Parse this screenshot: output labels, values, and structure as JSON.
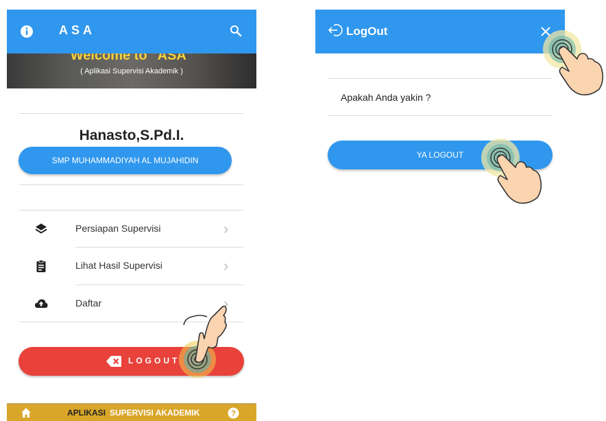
{
  "left_screen": {
    "app_bar": {
      "title": "ASA",
      "info_icon": "info-icon",
      "search_icon": "search-icon"
    },
    "banner": {
      "welcome": "Welcome to \"ASA\"",
      "subtitle": "( Aplikasi Supervisi Akademik )"
    },
    "profile": {
      "name": "Hanasto,S.Pd.I.",
      "school": "SMP MUHAMMADIYAH AL MUJAHIDIN"
    },
    "menu": [
      {
        "label": "Persiapan Supervisi",
        "icon": "layers-icon"
      },
      {
        "label": "Lihat Hasil Supervisi",
        "icon": "clipboard-icon"
      },
      {
        "label": "Daftar",
        "icon": "cloud-upload-icon"
      }
    ],
    "logout_label": "LOGOUT",
    "bottom_bar": {
      "text_primary": "APLIKASI",
      "text_secondary": "SUPERVISI AKADEMIK",
      "home_icon": "home-icon",
      "help_icon": "help-icon"
    }
  },
  "right_screen": {
    "dialog_bar": {
      "title": "LogOut",
      "icon": "logout-icon",
      "close_icon": "close-icon"
    },
    "confirm_text": "Apakah Anda yakin ?",
    "confirm_button": "YA LOGOUT"
  },
  "colors": {
    "primary_blue": "#2f97ee",
    "logout_red": "#e8423b",
    "bottom_gold": "#d9a629",
    "banner_yellow": "#f6d23a"
  }
}
